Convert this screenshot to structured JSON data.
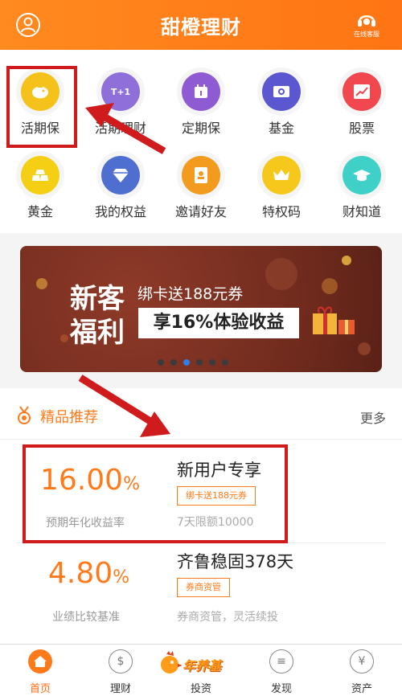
{
  "header": {
    "title": "甜橙理财",
    "service_label": "在线客服"
  },
  "grid": [
    {
      "label": "活期保",
      "icon": "piggy-icon",
      "color": "#f5c21b"
    },
    {
      "label": "活期理财",
      "icon": "t1-icon",
      "glyph": "T+1",
      "color": "#8f6fd9"
    },
    {
      "label": "定期保",
      "icon": "calendar-icon",
      "color": "#8f5bd2"
    },
    {
      "label": "基金",
      "icon": "fund-icon",
      "color": "#5a57d0"
    },
    {
      "label": "股票",
      "icon": "stock-chart-icon",
      "color": "#f0484e"
    },
    {
      "label": "黄金",
      "icon": "gold-bar-icon",
      "color": "#f5cf14"
    },
    {
      "label": "我的权益",
      "icon": "diamond-icon",
      "color": "#4f6fd0"
    },
    {
      "label": "邀请好友",
      "icon": "contact-card-icon",
      "color": "#f29b1f"
    },
    {
      "label": "特权码",
      "icon": "crown-icon",
      "color": "#f5c81b"
    },
    {
      "label": "财知道",
      "icon": "graduation-cap-icon",
      "color": "#3fd1c7"
    }
  ],
  "banner": {
    "title_line1": "新客",
    "title_line2": "福利",
    "subtitle": "绑卡送188元券",
    "highlight": "享16%体验收益",
    "page_count": 6,
    "active_page": 3
  },
  "section": {
    "title": "精品推荐",
    "more": "更多"
  },
  "products": [
    {
      "rate": "16.00",
      "rate_unit": "%",
      "rate_label": "预期年化收益率",
      "name": "新用户专享",
      "tag": "绑卡送188元券",
      "desc": "7天限额10000"
    },
    {
      "rate": "4.80",
      "rate_unit": "%",
      "rate_label": "业绩比较基准",
      "name": "齐鲁稳固378天",
      "tag": "券商资管",
      "desc": "券商资管，灵活续投"
    }
  ],
  "tabbar": {
    "tabs": [
      {
        "label": "首页",
        "icon": "home-icon",
        "active": true
      },
      {
        "label": "理财",
        "icon": "money-bag-icon",
        "active": false
      },
      {
        "label": "投资",
        "icon": "rooster-icon",
        "active": false
      },
      {
        "label": "发现",
        "icon": "discover-icon",
        "active": false
      },
      {
        "label": "资产",
        "icon": "yen-icon",
        "active": false
      }
    ],
    "special_text": "年养基"
  },
  "colors": {
    "accent": "#ff7a1a",
    "annotation": "#cf1b1b"
  }
}
